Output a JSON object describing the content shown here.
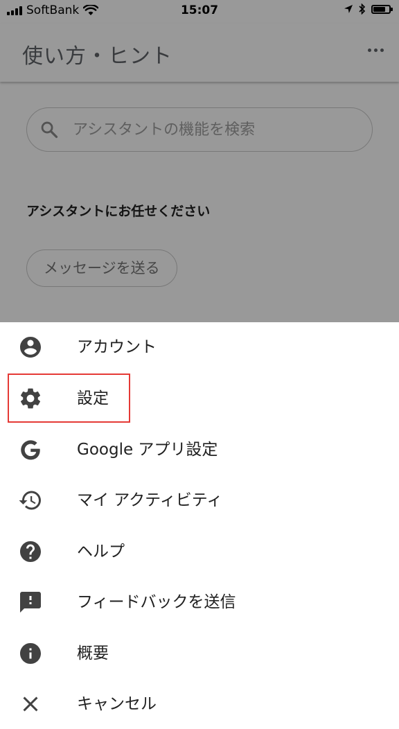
{
  "status_bar": {
    "carrier": "SoftBank",
    "time": "15:07"
  },
  "header": {
    "title": "使い方・ヒント",
    "more_icon": "more-horizontal-icon"
  },
  "search": {
    "placeholder": "アシスタントの機能を検索",
    "icon": "search-icon"
  },
  "section": {
    "heading": "アシスタントにお任せください"
  },
  "chip": {
    "label": "メッセージを送る"
  },
  "menu": {
    "items": [
      {
        "label": "アカウント",
        "icon": "account-circle-icon"
      },
      {
        "label": "設定",
        "icon": "gear-icon"
      },
      {
        "label": "Google アプリ設定",
        "icon": "google-g-icon"
      },
      {
        "label": "マイ アクティビティ",
        "icon": "history-icon"
      },
      {
        "label": "ヘルプ",
        "icon": "help-icon"
      },
      {
        "label": "フィードバックを送信",
        "icon": "feedback-icon"
      },
      {
        "label": "概要",
        "icon": "info-icon"
      },
      {
        "label": "キャンセル",
        "icon": "close-icon"
      }
    ]
  },
  "colors": {
    "highlight": "#e53935",
    "icon": "#424242",
    "scrim": "rgba(0,0,0,0.4)"
  }
}
